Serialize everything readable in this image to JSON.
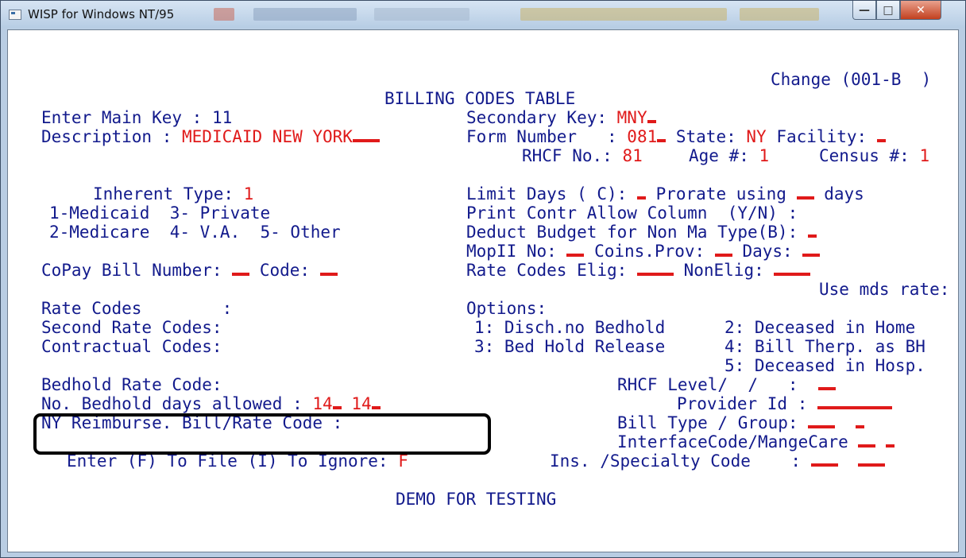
{
  "window": {
    "title": "WISP for Windows NT/95",
    "controls": {
      "minimize": "—",
      "maximize": "□",
      "close": "✕"
    }
  },
  "screen": {
    "mode": "Change (001-B  )",
    "heading": "BILLING CODES TABLE",
    "main_key_label": "Enter Main Key : ",
    "main_key_value": "11",
    "description_label": "Description : ",
    "description_value": "MEDICAID NEW YORK",
    "secondary_key_label": "Secondary Key: ",
    "secondary_key_value": "MNY",
    "form_number_label": "Form Number   : ",
    "form_number_value": "081",
    "state_label": " State: ",
    "state_value": "NY",
    "facility_label": " Facility: ",
    "rhcf_no_label": "RHCF No.: ",
    "rhcf_no_value": "81",
    "age_label": "Age #: ",
    "age_value": "1",
    "census_label": "Census #: ",
    "census_value": "1",
    "inherent_type_label": "Inherent Type: ",
    "inherent_type_value": "1",
    "inherent_opts_1": "1-Medicaid  3- Private",
    "inherent_opts_2": "2-Medicare  4- V.A.  5- Other",
    "limit_days_label": "Limit Days ( C): ",
    "prorate_label": " Prorate using ",
    "days_label": " days",
    "print_contr": "Print Contr Allow Column  (Y/N) :",
    "deduct_budget_label": "Deduct Budget for Non Ma Type(B): ",
    "mopii_label": "MopII No: ",
    "coins_label": " Coins.Prov: ",
    "mop_days_label": " Days: ",
    "copay_label": "CoPay Bill Number: ",
    "copay_code_label": " Code: ",
    "rate_elig_label": "Rate Codes Elig: ",
    "nonelig_label": " NonElig: ",
    "use_mds_label": "Use mds rate: ",
    "rate_codes": "Rate Codes        :",
    "second_rate_codes": "Second Rate Codes:",
    "contractual_codes": "Contractual Codes:",
    "options_label": "Options:",
    "opt_1": "1: Disch.no Bedhold",
    "opt_2": "2: Deceased in Home",
    "opt_3": "3: Bed Hold Release",
    "opt_4": "4: Bill Therp. as BH",
    "opt_5": "5: Deceased in Hosp.",
    "bedhold_rate_code": "Bedhold Rate Code:",
    "bedhold_days_label": "No. Bedhold days allowed : ",
    "bedhold_days_1": "14",
    "bedhold_days_2": "14",
    "ny_reimburse": "NY Reimburse. Bill/Rate Code :",
    "rhcf_level_label": "RHCF Level/  /   :  ",
    "provider_id_label": "Provider Id : ",
    "bill_type_label": "Bill Type / Group: ",
    "interface_label": "InterfaceCode/MangeCare ",
    "ins_specialty_label": "Ins. /Specialty Code    : ",
    "enter_prompt_label": "Enter (F) To File (I) To Ignore: ",
    "enter_prompt_value": "F",
    "footer": "DEMO FOR TESTING"
  },
  "colors": {
    "label": "#121a8c",
    "value": "#e01a1a",
    "annotation_box": "#000000"
  },
  "icons": [
    "app-icon",
    "minimize-icon",
    "maximize-icon",
    "close-icon"
  ]
}
